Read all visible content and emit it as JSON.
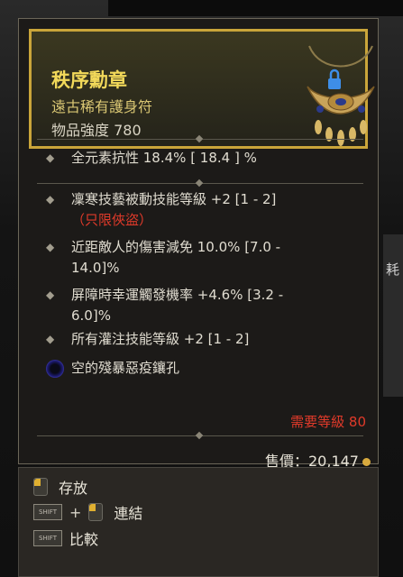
{
  "background": {
    "side_label": "耗"
  },
  "item": {
    "name": "秩序勳章",
    "type": "遠古稀有護身符",
    "power": "物品強度 780",
    "implicit": "全元素抗性 18.4%  [ 18.4 ] %",
    "affixes": [
      {
        "line1": "凜寒技藝被動技能等級 +2 [1 - 2]",
        "line2": "（只限俠盜）"
      },
      {
        "line1": "近距敵人的傷害減免 10.0% [7.0 -",
        "line2": "14.0]%"
      },
      {
        "line1": "屏障時幸運觸發機率 +4.6% [3.2 -",
        "line2": "6.0]%"
      },
      {
        "line1": "所有灌注技能等級 +2 [1 - 2]"
      }
    ],
    "socket": "空的殘暴惡疫鑲孔",
    "requirement": "需要等級 80",
    "price": "售價：20,147"
  },
  "actions": {
    "store": "存放",
    "link": "連結",
    "compare": "比較",
    "shift_key": "SHIFT",
    "plus": "+"
  },
  "colors": {
    "title": "#f2d95a",
    "rarity": "#d9c673",
    "requirement": "#e03a2a",
    "header_border": "#caa53a"
  }
}
